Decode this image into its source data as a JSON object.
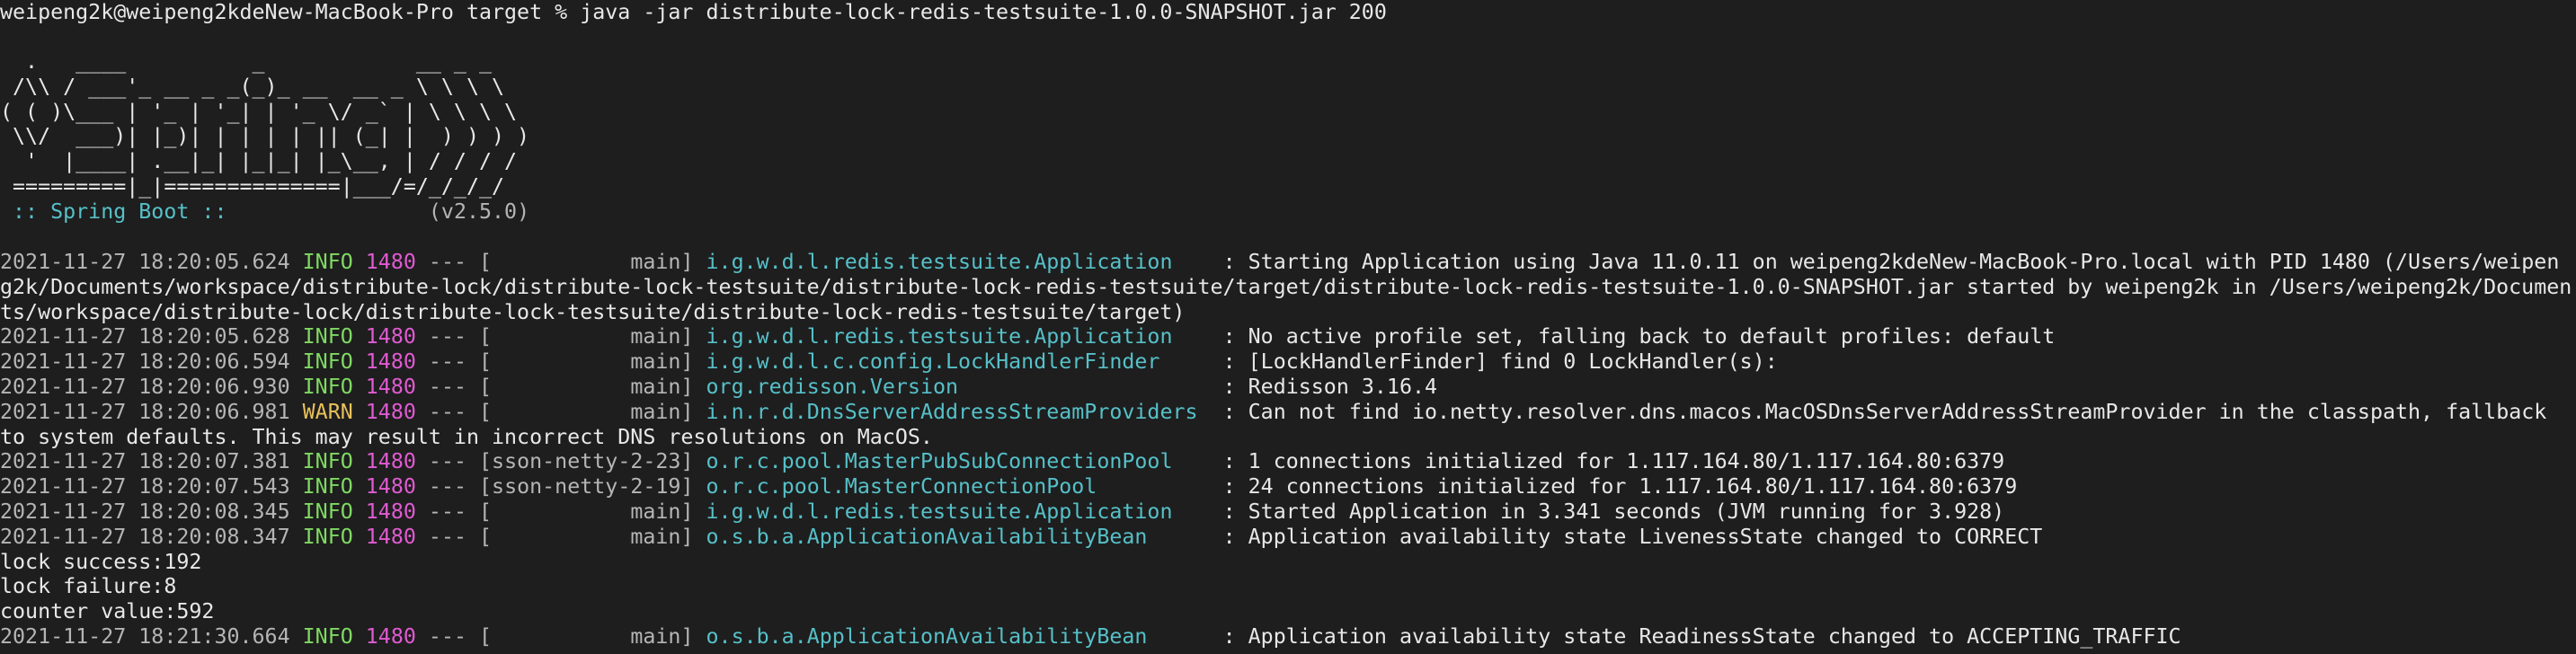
{
  "prompt": "weipeng2k@weipeng2kdeNew-MacBook-Pro target % java -jar distribute-lock-redis-testsuite-1.0.0-SNAPSHOT.jar 200",
  "banner": [
    "  .   ____          _            __ _ _",
    " /\\\\ / ___'_ __ _ _(_)_ __  __ _ \\ \\ \\ \\",
    "( ( )\\___ | '_ | '_| | '_ \\/ _` | \\ \\ \\ \\",
    " \\\\/  ___)| |_)| | | | | || (_| |  ) ) ) )",
    "  '  |____| .__|_| |_|_| |_\\__, | / / / /",
    " =========|_|==============|___/=/_/_/_/"
  ],
  "boot": {
    "label": " :: Spring Boot :: ",
    "version": "               (v2.5.0)"
  },
  "logs": [
    {
      "ts": "2021-11-27 18:20:05.624",
      "level": "INFO",
      "pid": "1480",
      "sep": "---",
      "thread": "[           main]",
      "logger": "i.g.w.d.l.redis.testsuite.Application   ",
      "msg": ": Starting Application using Java 11.0.11 on weipeng2kdeNew-MacBook-Pro.local with PID 1480 (/Users/weipen"
    },
    {
      "cont": "g2k/Documents/workspace/distribute-lock/distribute-lock-testsuite/distribute-lock-redis-testsuite/target/distribute-lock-redis-testsuite-1.0.0-SNAPSHOT.jar started by weipeng2k in /Users/weipeng2k/Documen"
    },
    {
      "cont": "ts/workspace/distribute-lock/distribute-lock-testsuite/distribute-lock-redis-testsuite/target)"
    },
    {
      "ts": "2021-11-27 18:20:05.628",
      "level": "INFO",
      "pid": "1480",
      "sep": "---",
      "thread": "[           main]",
      "logger": "i.g.w.d.l.redis.testsuite.Application   ",
      "msg": ": No active profile set, falling back to default profiles: default"
    },
    {
      "ts": "2021-11-27 18:20:06.594",
      "level": "INFO",
      "pid": "1480",
      "sep": "---",
      "thread": "[           main]",
      "logger": "i.g.w.d.l.c.config.LockHandlerFinder    ",
      "msg": ": [LockHandlerFinder] find 0 LockHandler(s):"
    },
    {
      "ts": "2021-11-27 18:20:06.930",
      "level": "INFO",
      "pid": "1480",
      "sep": "---",
      "thread": "[           main]",
      "logger": "org.redisson.Version                    ",
      "msg": ": Redisson 3.16.4"
    },
    {
      "ts": "2021-11-27 18:20:06.981",
      "level": "WARN",
      "pid": "1480",
      "sep": "---",
      "thread": "[           main]",
      "logger": "i.n.r.d.DnsServerAddressStreamProviders ",
      "msg": ": Can not find io.netty.resolver.dns.macos.MacOSDnsServerAddressStreamProvider in the classpath, fallback"
    },
    {
      "cont": "to system defaults. This may result in incorrect DNS resolutions on MacOS."
    },
    {
      "ts": "2021-11-27 18:20:07.381",
      "level": "INFO",
      "pid": "1480",
      "sep": "---",
      "thread": "[sson-netty-2-23]",
      "logger": "o.r.c.pool.MasterPubSubConnectionPool   ",
      "msg": ": 1 connections initialized for 1.117.164.80/1.117.164.80:6379"
    },
    {
      "ts": "2021-11-27 18:20:07.543",
      "level": "INFO",
      "pid": "1480",
      "sep": "---",
      "thread": "[sson-netty-2-19]",
      "logger": "o.r.c.pool.MasterConnectionPool         ",
      "msg": ": 24 connections initialized for 1.117.164.80/1.117.164.80:6379"
    },
    {
      "ts": "2021-11-27 18:20:08.345",
      "level": "INFO",
      "pid": "1480",
      "sep": "---",
      "thread": "[           main]",
      "logger": "i.g.w.d.l.redis.testsuite.Application   ",
      "msg": ": Started Application in 3.341 seconds (JVM running for 3.928)"
    },
    {
      "ts": "2021-11-27 18:20:08.347",
      "level": "INFO",
      "pid": "1480",
      "sep": "---",
      "thread": "[           main]",
      "logger": "o.s.b.a.ApplicationAvailabilityBean     ",
      "msg": ": Application availability state LivenessState changed to CORRECT"
    },
    {
      "cont": "lock success:192"
    },
    {
      "cont": "lock failure:8"
    },
    {
      "cont": "counter value:592"
    },
    {
      "ts": "2021-11-27 18:21:30.664",
      "level": "INFO",
      "pid": "1480",
      "sep": "---",
      "thread": "[           main]",
      "logger": "o.s.b.a.ApplicationAvailabilityBean     ",
      "msg": ": Application availability state ReadinessState changed to ACCEPTING_TRAFFIC"
    }
  ]
}
